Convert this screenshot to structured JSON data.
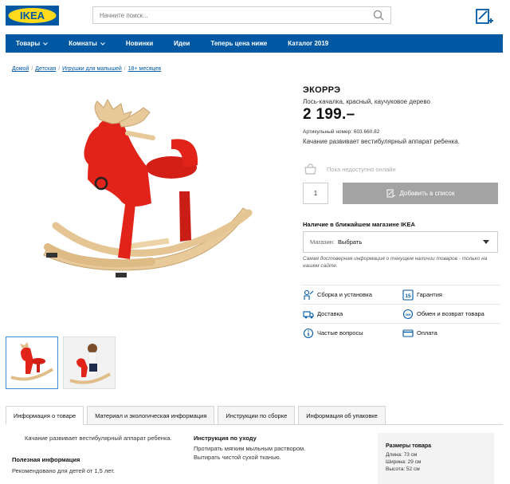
{
  "header": {
    "logo_text": "IKEA",
    "search_placeholder": "Начните поиск..."
  },
  "nav": [
    {
      "label": "Товары",
      "dropdown": true
    },
    {
      "label": "Комнаты",
      "dropdown": true
    },
    {
      "label": "Новинки",
      "dropdown": false
    },
    {
      "label": "Идеи",
      "dropdown": false
    },
    {
      "label": "Теперь цена ниже",
      "dropdown": false
    },
    {
      "label": "Каталог 2019",
      "dropdown": false
    }
  ],
  "breadcrumb": [
    "Домой",
    "Детская",
    "Игрушки для малышей",
    "18+ месяцев"
  ],
  "product": {
    "name": "ЭКОРРЭ",
    "subtitle": "Лось-качалка, красный, каучуковое дерево",
    "price": "2 199.–",
    "article": "Артикульный номер: 603.660.82",
    "short_desc": "Качание развивает вестибулярный аппарат ребенка."
  },
  "purchase": {
    "online_status": "Пока недоступно онлайн",
    "quantity": "1",
    "add_to_list_label": "Добавить в список"
  },
  "store": {
    "heading": "Наличие в ближайшем магазине IKEA",
    "select_label": "Магазин:",
    "select_value": "Выбрать",
    "note": "Самая достоверная информация о текущем наличии товаров - только на нашем сайте."
  },
  "services": [
    {
      "label": "Сборка и установка",
      "icon": "assembly-icon"
    },
    {
      "label": "Гарантия",
      "icon": "warranty-icon"
    },
    {
      "label": "Доставка",
      "icon": "truck-icon"
    },
    {
      "label": "Обмен и возврат товара",
      "icon": "return-icon"
    },
    {
      "label": "Частые вопросы",
      "icon": "info-icon"
    },
    {
      "label": "Оплата",
      "icon": "card-icon"
    }
  ],
  "warranty_badge": "15",
  "tabs": [
    "Информация о товаре",
    "Материал и экологическая информация",
    "Инструкции по сборке",
    "Информация об упаковке"
  ],
  "content": {
    "description": "Качание развивает вестибулярный аппарат ребенка.",
    "useful_heading": "Полезная информация",
    "useful_text": "Рекомендовано для детей от 1,5 лет.",
    "care_heading": "Инструкция по уходу",
    "care_line1": "Протирать мягким мыльным раствором.",
    "care_line2": "Вытирать чистой сухой тканью.",
    "sizes_heading": "Размеры товара",
    "sizes": [
      "Длина: 73 см",
      "Ширина: 29 см",
      "Высота: 52 см"
    ]
  },
  "colors": {
    "ikea_blue": "#0058a3",
    "ikea_yellow": "#ffda1a",
    "moose_red": "#e2231a",
    "button_grey": "#a3a3a3"
  }
}
